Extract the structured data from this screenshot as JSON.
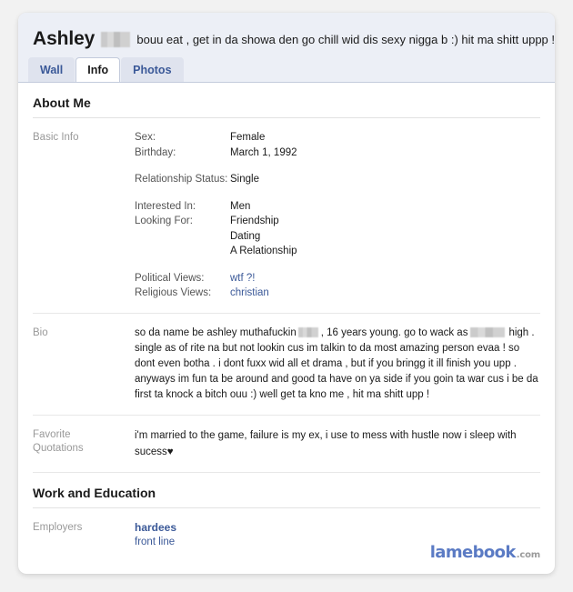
{
  "profile": {
    "name": "Ashley",
    "name_redacted": "redacted-name-block",
    "status": "bouu eat , get in da showa den go chill wid dis sexy nigga b :) hit ma shitt uppp !"
  },
  "tabs": [
    {
      "label": "Wall",
      "active": false
    },
    {
      "label": "Info",
      "active": true
    },
    {
      "label": "Photos",
      "active": false
    }
  ],
  "sections": {
    "about_me": {
      "title": "About Me",
      "basic_info": {
        "label": "Basic Info",
        "fields": [
          {
            "key": "Sex:",
            "value": "Female"
          },
          {
            "key": "Birthday:",
            "value": "March 1, 1992"
          },
          {
            "key": "Relationship Status:",
            "value": "Single"
          },
          {
            "key": "Interested In:",
            "value": "Men"
          },
          {
            "key": "Looking For:",
            "value": "Friendship"
          },
          {
            "key": "",
            "value": "Dating"
          },
          {
            "key": "",
            "value": "A Relationship"
          },
          {
            "key": "Political Views:",
            "value": "wtf ?!"
          },
          {
            "key": "Religious Views:",
            "value": "christian"
          }
        ]
      },
      "bio": {
        "label": "Bio",
        "text_part_1": "so da name be ashley muthafuckin",
        "text_part_2": ", 16 years young. go to wack as",
        "text_part_3": "high . single as of rite na but not lookin cus im talkin to da most amazing person evaa ! so dont even botha . i dont fuxx wid all et drama , but if you bringg it ill finish you upp . anyways im fun ta be around and good ta have on ya side if you goin ta war cus i be da first ta knock a bitch ouu :) well get ta kno me , hit ma shitt upp !"
      },
      "favorite_quotations": {
        "label": "Favorite Quotations",
        "label_line_1": "Favorite",
        "label_line_2": "Quotations",
        "text": "i'm married to the game, failure is my ex, i use to mess with hustle now i sleep with sucess♥"
      }
    },
    "work_and_education": {
      "title": "Work and Education",
      "employers": {
        "label": "Employers",
        "primary": "hardees",
        "secondary": "front line"
      }
    }
  },
  "watermark": {
    "main": "lamebook",
    "tld": ".com"
  },
  "colors": {
    "accent_link": "#3b5998",
    "header_bg": "#eceff6",
    "tab_bg": "#dfe3ee",
    "label_gray": "#999999",
    "watermark_blue": "#5b7bc4"
  }
}
